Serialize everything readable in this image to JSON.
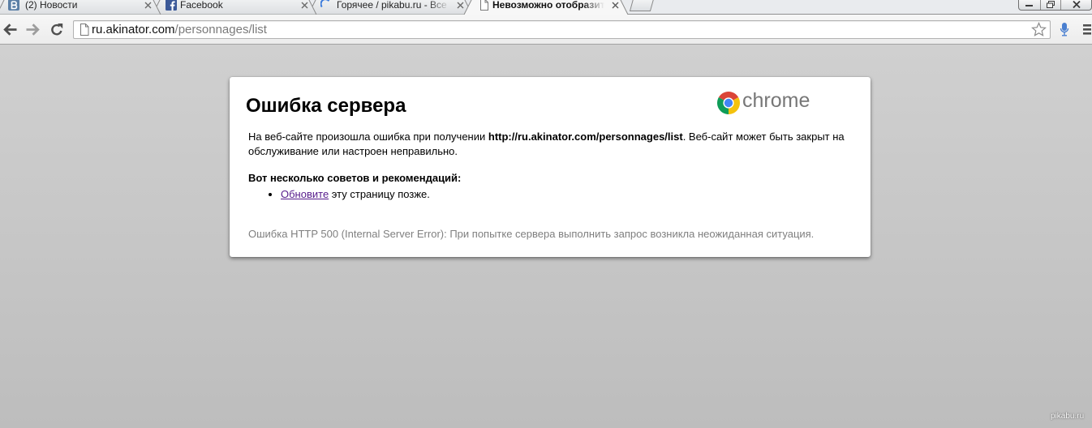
{
  "browser": {
    "tabs": [
      {
        "title": "(2) Новости",
        "icon": "vk-icon",
        "active": false
      },
      {
        "title": "Facebook",
        "icon": "facebook-icon",
        "active": false
      },
      {
        "title": "Горячее / pikabu.ru - Все",
        "icon": "loading-spinner-icon",
        "active": false
      },
      {
        "title": "Невозможно отобразить",
        "icon": "page-icon",
        "active": true
      }
    ],
    "address_bar": {
      "host": "ru.akinator.com",
      "path": "/personnages/list"
    },
    "toolbar_icons": [
      "back-arrow-icon",
      "forward-arrow-icon",
      "reload-icon",
      "star-icon",
      "microphone-icon",
      "menu-icon"
    ]
  },
  "error_page": {
    "title": "Ошибка сервера",
    "brand_text": "chrome",
    "message": {
      "before": "На веб-сайте произошла ошибка при получении ",
      "url": "http://ru.akinator.com/personnages/list",
      "after": ". Веб-сайт может быть закрыт на обслуживание или настроен неправильно."
    },
    "suggestions_heading": "Вот несколько советов и рекомендаций:",
    "suggestions": [
      {
        "link_text": "Обновите",
        "text": " эту страницу позже."
      }
    ],
    "error_details": "Ошибка HTTP 500 (Internal Server Error): При попытке сервера выполнить запрос возникла неожиданная ситуация."
  },
  "watermark": "pikabu.ru",
  "colors": {
    "link": "#551a8b",
    "details": "#7f7f7f",
    "brand": "#777777",
    "card": "#ffffff"
  }
}
